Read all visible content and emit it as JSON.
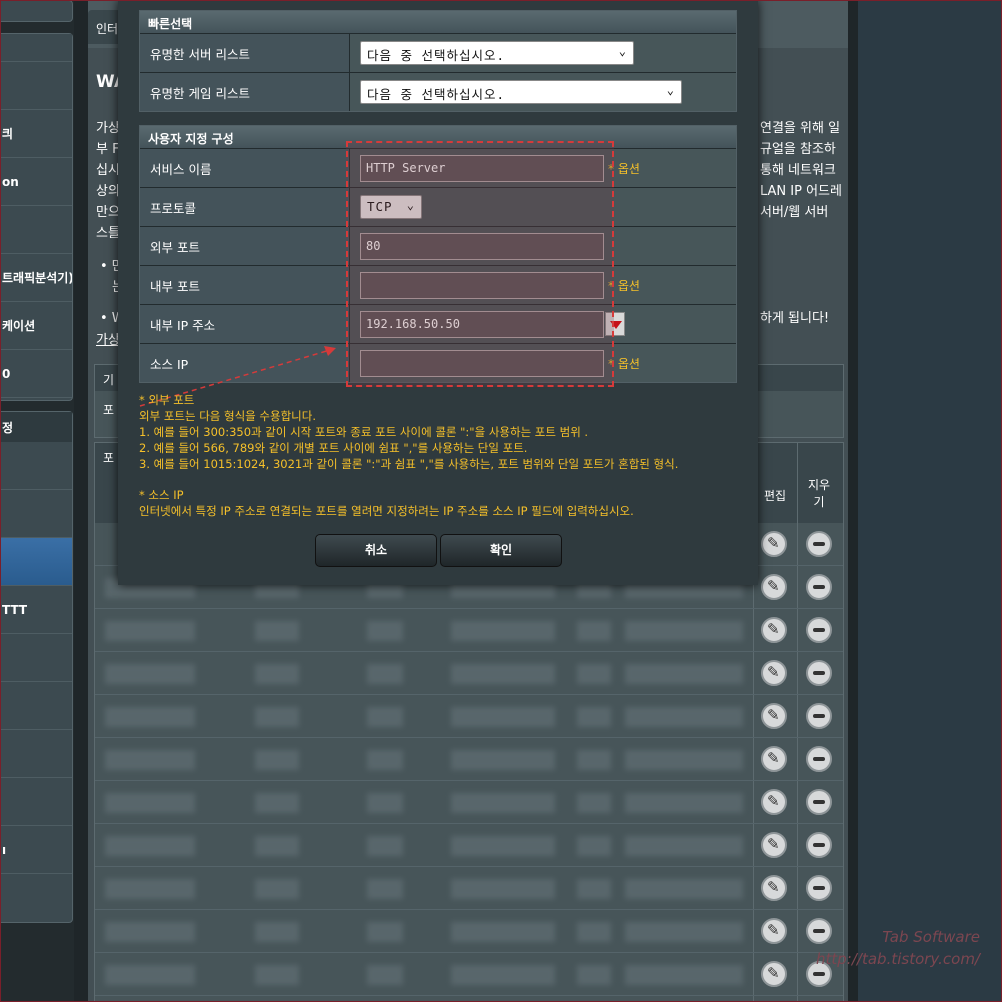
{
  "sidebar": {
    "items_top": [
      "킈",
      "on",
      "",
      "트래픽분석기)",
      "케이션",
      "0"
    ],
    "section_header": "정",
    "items_bottom": [
      "",
      "",
      "",
      "TTT",
      "",
      "",
      "",
      "",
      "ı"
    ]
  },
  "background": {
    "tab_label": "인터",
    "heading": "WA",
    "left_lines": [
      "가상",
      "부 F",
      "십시",
      "상의",
      "만으",
      "스틀"
    ],
    "right_lines": [
      "연결을 위해 일",
      "규얼을 참조하",
      "통해 네트워크",
      "",
      "LAN IP 어드레",
      "",
      "서버/웹 서버"
    ],
    "bullet1": "• 만",
    "bullet1b": "는",
    "bullet2": "• W",
    "bullet2_tail": "하게 됩니다!",
    "link_text": "가상",
    "box_head": "기",
    "box_body": "포",
    "table_head_left": "포",
    "col_edit": "편집",
    "col_delete": "지우기"
  },
  "modal": {
    "quick": {
      "title": "빠른선택",
      "server_label": "유명한 서버 리스트",
      "server_value": "다음 중 선택하십시오.",
      "game_label": "유명한 게임 리스트",
      "game_value": "다음 중 선택하십시오."
    },
    "custom": {
      "title": "사용자 지정 구성",
      "service_label": "서비스 이름",
      "service_value": "HTTP Server",
      "protocol_label": "프로토콜",
      "protocol_value": "TCP",
      "ext_port_label": "외부 포트",
      "ext_port_value": "80",
      "int_port_label": "내부 포트",
      "int_port_value": "",
      "int_ip_label": "내부 IP 주소",
      "int_ip_value": "192.168.50.50",
      "source_ip_label": "소스 IP",
      "source_ip_value": "",
      "optional": "* 옵션"
    },
    "notes": {
      "ext_title": "* 외부 포트",
      "ext_line0": "외부 포트는 다음 형식을 수용합니다.",
      "ext_line1": "1. 예를 들어 300:350과 같이 시작 포트와 종료 포트 사이에 콜론 \":\"을 사용하는 포트 범위 .",
      "ext_line2": "2. 예를 들어 566, 789와 같이 개별 포트 사이에 쉼표 \",\"를 사용하는 단일 포트.",
      "ext_line3": "3. 예를 들어 1015:1024, 3021과 같이 콜론 \":\"과 쉼표 \",\"를 사용하는, 포트 범위와 단일 포트가 혼합된 형식.",
      "src_title": "* 소스 IP",
      "src_line": "인터넷에서 특정 IP 주소로 연결되는 포트를 열려면 지정하려는 IP 주소를 소스 IP 필드에 입력하십시오."
    },
    "cancel": "취소",
    "confirm": "확인"
  },
  "watermark": {
    "line1": "Tab Software",
    "line2": "http://tab.tistory.com/"
  },
  "colors": {
    "accent_optional": "#f5c02a",
    "highlight_dash": "#d63a3a"
  }
}
